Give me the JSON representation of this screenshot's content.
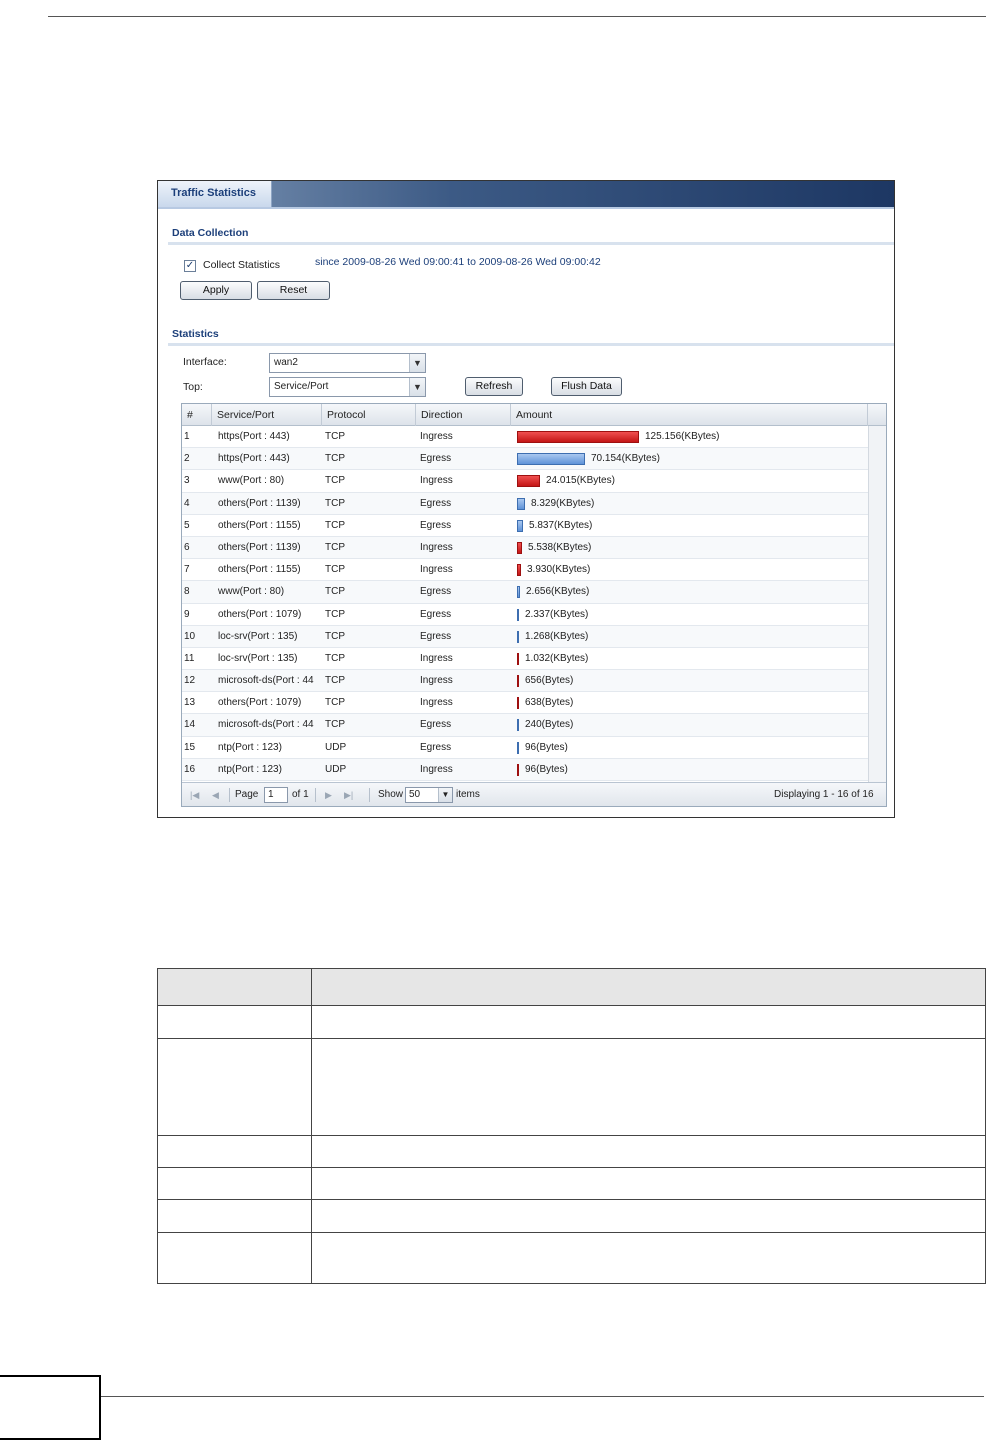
{
  "window": {
    "tab_title": "Traffic Statistics"
  },
  "data_collection": {
    "section_title": "Data Collection",
    "collect_label": "Collect Statistics",
    "collect_checked": true,
    "since_text": "since 2009-08-26 Wed 09:00:41 to 2009-08-26 Wed 09:00:42",
    "apply_label": "Apply",
    "reset_label": "Reset"
  },
  "statistics": {
    "section_title": "Statistics",
    "interface_label": "Interface:",
    "interface_value": "wan2",
    "top_label": "Top:",
    "top_value": "Service/Port",
    "refresh_label": "Refresh",
    "flush_label": "Flush Data"
  },
  "grid": {
    "columns": [
      "#",
      "Service/Port",
      "Protocol",
      "Direction",
      "Amount"
    ],
    "rows": [
      {
        "num": "1",
        "service": "https(Port : 443)",
        "protocol": "TCP",
        "direction": "Ingress",
        "amount": "125.156(KBytes)",
        "kb": 125.156
      },
      {
        "num": "2",
        "service": "https(Port : 443)",
        "protocol": "TCP",
        "direction": "Egress",
        "amount": "70.154(KBytes)",
        "kb": 70.154
      },
      {
        "num": "3",
        "service": "www(Port : 80)",
        "protocol": "TCP",
        "direction": "Ingress",
        "amount": "24.015(KBytes)",
        "kb": 24.015
      },
      {
        "num": "4",
        "service": "others(Port : 1139)",
        "protocol": "TCP",
        "direction": "Egress",
        "amount": "8.329(KBytes)",
        "kb": 8.329
      },
      {
        "num": "5",
        "service": "others(Port : 1155)",
        "protocol": "TCP",
        "direction": "Egress",
        "amount": "5.837(KBytes)",
        "kb": 5.837
      },
      {
        "num": "6",
        "service": "others(Port : 1139)",
        "protocol": "TCP",
        "direction": "Ingress",
        "amount": "5.538(KBytes)",
        "kb": 5.538
      },
      {
        "num": "7",
        "service": "others(Port : 1155)",
        "protocol": "TCP",
        "direction": "Ingress",
        "amount": "3.930(KBytes)",
        "kb": 3.93
      },
      {
        "num": "8",
        "service": "www(Port : 80)",
        "protocol": "TCP",
        "direction": "Egress",
        "amount": "2.656(KBytes)",
        "kb": 2.656
      },
      {
        "num": "9",
        "service": "others(Port : 1079)",
        "protocol": "TCP",
        "direction": "Egress",
        "amount": "2.337(KBytes)",
        "kb": 2.337
      },
      {
        "num": "10",
        "service": "loc-srv(Port : 135)",
        "protocol": "TCP",
        "direction": "Egress",
        "amount": "1.268(KBytes)",
        "kb": 1.268
      },
      {
        "num": "11",
        "service": "loc-srv(Port : 135)",
        "protocol": "TCP",
        "direction": "Ingress",
        "amount": "1.032(KBytes)",
        "kb": 1.032
      },
      {
        "num": "12",
        "service": "microsoft-ds(Port : 44",
        "protocol": "TCP",
        "direction": "Ingress",
        "amount": "656(Bytes)",
        "kb": 0.656
      },
      {
        "num": "13",
        "service": "others(Port : 1079)",
        "protocol": "TCP",
        "direction": "Ingress",
        "amount": "638(Bytes)",
        "kb": 0.638
      },
      {
        "num": "14",
        "service": "microsoft-ds(Port : 44",
        "protocol": "TCP",
        "direction": "Egress",
        "amount": "240(Bytes)",
        "kb": 0.24
      },
      {
        "num": "15",
        "service": "ntp(Port : 123)",
        "protocol": "UDP",
        "direction": "Egress",
        "amount": "96(Bytes)",
        "kb": 0.096
      },
      {
        "num": "16",
        "service": "ntp(Port : 123)",
        "protocol": "UDP",
        "direction": "Ingress",
        "amount": "96(Bytes)",
        "kb": 0.096
      }
    ]
  },
  "pager": {
    "page_label": "Page",
    "page_value": "1",
    "of_label": "of 1",
    "show_label": "Show",
    "show_value": "50",
    "items_label": "items",
    "displaying": "Displaying 1 - 16 of 16"
  },
  "colors": {
    "ingress": "#d42020",
    "egress": "#6f9fde",
    "title_bar": "#1d3763"
  }
}
